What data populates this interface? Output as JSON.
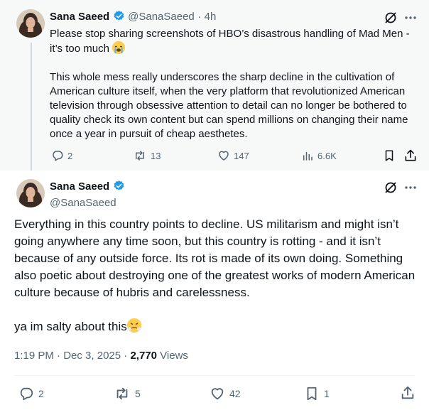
{
  "parent": {
    "name": "Sana Saeed",
    "handle": "@SanaSaeed",
    "time": "4h",
    "text1": "Please stop sharing screenshots of HBO’s disastrous handling of Mad Men - it’s too much",
    "text2": "This whole mess really underscores the sharp decline in the cultivation of American culture itself, when the very platform that revolutionized American television through obsessive attention to detail can no longer be bothered to quality check its own content but can spend millions on changing their name once a year in pursuit of cheap aesthetes.",
    "replies": "2",
    "reposts": "13",
    "likes": "147",
    "views": "6.6K"
  },
  "main": {
    "name": "Sana Saeed",
    "handle": "@SanaSaeed",
    "text1": "Everything in this country points to decline. US militarism and might isn’t going anywhere any time soon, but this country is rotting - and it isn’t because of any outside force. Its rot is made of its own doing. Something also poetic about destroying one of the greatest works of modern American culture because of hubris and carelessness.",
    "text2": "ya im salty about this",
    "time": "1:19 PM",
    "date": "Dec 3, 2025",
    "views_count": "2,770",
    "views_label": "Views",
    "replies": "2",
    "reposts": "5",
    "likes": "42",
    "bookmarks": "1"
  },
  "colors": {
    "verified": "#1d9bf0",
    "muted": "#536471",
    "text": "#0f1419"
  },
  "icons": [
    "verified-icon",
    "grok-icon",
    "more-icon",
    "reply-icon",
    "repost-icon",
    "like-icon",
    "views-icon",
    "bookmark-icon",
    "share-icon",
    "loudly-crying-emoji",
    "steam-emoji"
  ]
}
